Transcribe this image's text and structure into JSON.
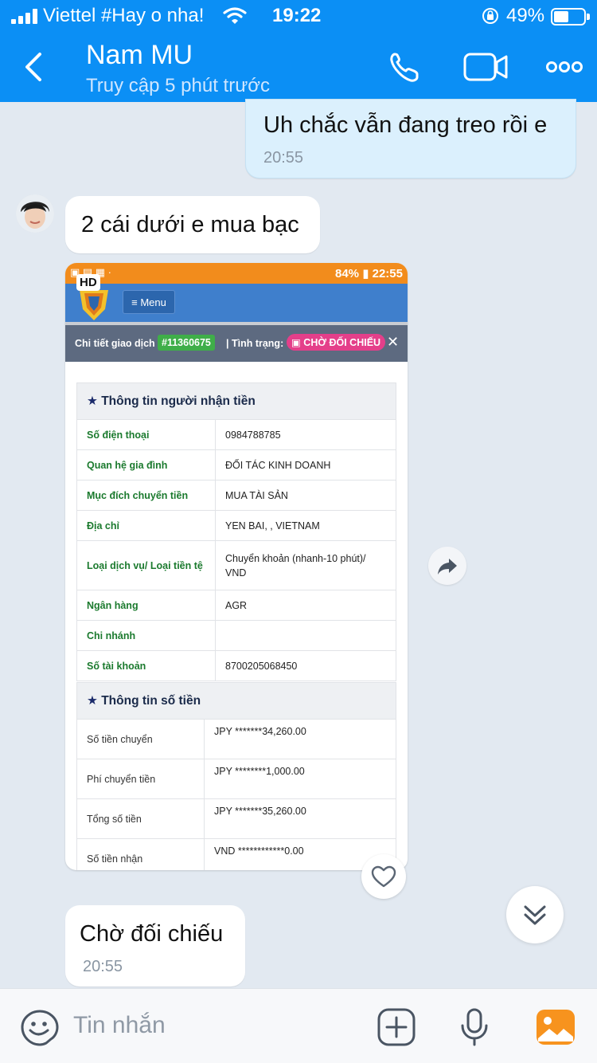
{
  "status_bar": {
    "carrier": "Viettel #Hay o nha!",
    "time": "19:22",
    "battery_percent": "49%",
    "battery_level": 0.49
  },
  "header": {
    "name": "Nam MU",
    "last_seen": "Truy cập 5 phút trước"
  },
  "messages": [
    {
      "direction": "out",
      "text": "Uh chắc vẫn đang treo rồi e",
      "time": "20:55"
    },
    {
      "direction": "in",
      "text": "2 cái dưới e mua bạc"
    },
    {
      "direction": "in",
      "type": "image"
    },
    {
      "direction": "in",
      "text": "Chờ đối chiếu",
      "time": "20:55"
    }
  ],
  "shared_image": {
    "hd_badge": "HD",
    "status_time": "22:55",
    "status_battery": "84%",
    "menu_label": "≡ Menu",
    "detail_label": "Chi tiết giao dịch",
    "transaction_code": "#11360675",
    "status_label": "| Tình trạng:",
    "status_value": "CHỜ ĐỐI CHIẾU",
    "close": "✕",
    "recipient_section": "Thông tin người nhận tiền",
    "recipient_rows": [
      {
        "key": "Số điện thoại",
        "value": "0984788785"
      },
      {
        "key": "Quan hệ gia đình",
        "value": "ĐỐI TÁC KINH DOANH"
      },
      {
        "key": "Mục đích chuyển tiền",
        "value": "MUA TÀI SẢN"
      },
      {
        "key": "Địa chỉ",
        "value": "YEN BAI, , VIETNAM"
      },
      {
        "key": "Loại dịch vụ/ Loại tiền tệ",
        "value": "Chuyển khoản (nhanh-10 phút)/ VND"
      },
      {
        "key": "Ngân hàng",
        "value": "AGR"
      },
      {
        "key": "Chi nhánh",
        "value": ""
      },
      {
        "key": "Số tài khoản",
        "value": "8700205068450"
      }
    ],
    "amount_section": "Thông tin số tiền",
    "amount_rows": [
      {
        "key": "Số tiền chuyển",
        "value": "JPY *******34,260.00"
      },
      {
        "key": "Phí chuyển tiền",
        "value": "JPY ********1,000.00"
      },
      {
        "key": "Tổng số tiền",
        "value": "JPY *******35,260.00"
      },
      {
        "key": "Số tiền nhận",
        "value": "VND ************0.00"
      }
    ]
  },
  "input": {
    "placeholder": "Tin nhắn"
  },
  "colors": {
    "header_blue": "#0b8ff5",
    "chat_background": "#e2e9f1",
    "outgoing_bubble": "#dbf0fd",
    "incoming_bubble": "#ffffff"
  }
}
